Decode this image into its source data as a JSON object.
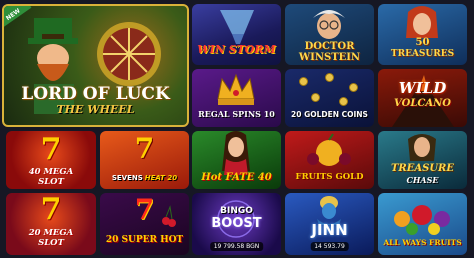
{
  "badges": {
    "new": "NEW"
  },
  "games": [
    {
      "id": "lord-of-luck",
      "title": "LORD OF LUCK",
      "subtitle": "THE WHEEL",
      "featured": true
    },
    {
      "id": "win-storm",
      "title": "WIN STORM"
    },
    {
      "id": "doctor-winstein",
      "title": "DOCTOR",
      "subtitle": "WINSTEIN"
    },
    {
      "id": "50-treasures",
      "title": "50",
      "subtitle": "TREASURES"
    },
    {
      "id": "regal-spins",
      "title": "REGAL SPINS 10"
    },
    {
      "id": "20-golden-coins",
      "title": "20 GOLDEN COINS"
    },
    {
      "id": "wild-volcano",
      "title": "WILD",
      "subtitle": "VOLCANO"
    },
    {
      "id": "40-mega-slot",
      "title": "40 MEGA",
      "subtitle": "SLOT"
    },
    {
      "id": "sevens-heat",
      "title": "SEVENS",
      "subtitle": "HEAT 20"
    },
    {
      "id": "hot-fate",
      "title": "Hot FATE 40"
    },
    {
      "id": "fruits-gold",
      "title": "FRUITS GOLD"
    },
    {
      "id": "treasure-chase",
      "title": "TREASURE",
      "subtitle": "CHASE"
    },
    {
      "id": "20-mega-slot",
      "title": "20 MEGA",
      "subtitle": "SLOT"
    },
    {
      "id": "20-super-hot",
      "title": "20 SUPER HOT"
    },
    {
      "id": "bingo-boost",
      "title": "BINGO",
      "subtitle": "BOOST",
      "jackpot": "19 799.58 BGN"
    },
    {
      "id": "jinn",
      "title": "JINN",
      "jackpot": "14 593.79"
    },
    {
      "id": "all-ways-fruits",
      "title": "ALL WAYS FRUITS"
    }
  ]
}
